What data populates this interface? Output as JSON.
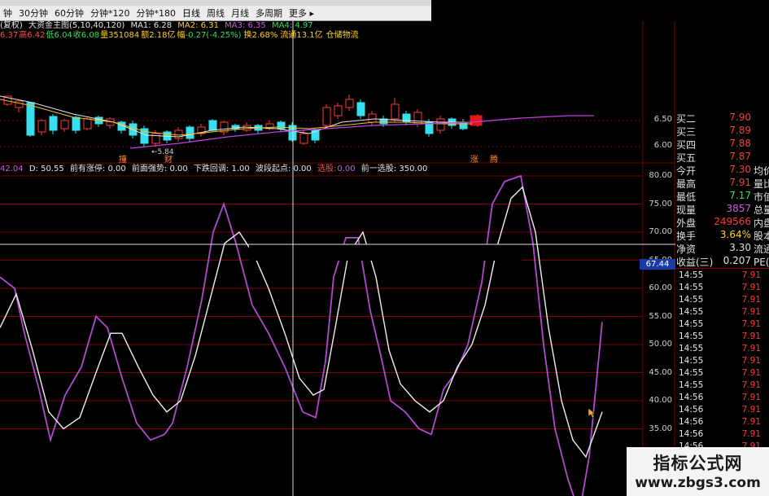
{
  "menu": {
    "periods": [
      {
        "label": "钟",
        "active": false
      },
      {
        "label": "30分钟",
        "active": false
      },
      {
        "label": "60分钟",
        "active": false
      },
      {
        "label": "分钟*120",
        "active": false
      },
      {
        "label": "分钟*180",
        "active": false
      },
      {
        "label": "日线",
        "active": true
      },
      {
        "label": "周线",
        "active": false
      },
      {
        "label": "月线",
        "active": false
      },
      {
        "label": "多周期",
        "active": false
      },
      {
        "label": "更多 ▸",
        "active": false
      }
    ]
  },
  "kline_header": {
    "name": "(复权)",
    "indicator": "大资金主图(5,10,40,120)",
    "ma1": "MA1: 6.28",
    "ma2": "MA2: 6.31",
    "ma3": "MA3: 6.35",
    "ma4": "MA4: 4.97",
    "open": "6.37",
    "high_label": "高",
    "high": "6.42",
    "low_label": "低",
    "low": "6.04",
    "close_label": "收",
    "close": "6.08",
    "vol_label": "量",
    "vol": "351084",
    "amt_label": "额",
    "amt": "2.18亿",
    "chg_label": "幅",
    "chg": "-0.27(-4.25%)",
    "turn_label": "换",
    "turn": "2.68%",
    "float_label": "流通",
    "float": "13.1亿",
    "sector": "仓储物流"
  },
  "kline": {
    "low_marker": "5.84",
    "marker_left": "撞",
    "marker_right": "财",
    "marker_sell": "涨",
    "marker_sell2": "腾",
    "axis": [
      "6.50",
      "6.00"
    ]
  },
  "osc_header": {
    "k": "42.04",
    "d": "D: 50.55",
    "items": [
      "前有涨停: 0.00",
      "前面强势: 0.00",
      "下跌回调: 1.00",
      "波段起点: 0.00"
    ],
    "pick_label": "选股:",
    "pick_value": "0.00",
    "prev": "前一选股: 350.00"
  },
  "osc_axis": [
    "80.00",
    "75.00",
    "70.00",
    "65.00",
    "60.00",
    "55.00",
    "50.00",
    "45.00",
    "40.00",
    "35.00"
  ],
  "cursor_value": "67.44",
  "order_book": [
    {
      "k": "买二",
      "v": "7.90",
      "color": "#ff3838",
      "x": ""
    },
    {
      "k": "买三",
      "v": "7.89",
      "color": "#ff3838",
      "x": ""
    },
    {
      "k": "买四",
      "v": "7.88",
      "color": "#ff3838",
      "x": ""
    },
    {
      "k": "买五",
      "v": "7.87",
      "color": "#ff3838",
      "x": ""
    },
    {
      "k": "今开",
      "v": "7.30",
      "color": "#ff3838",
      "x": "均价"
    },
    {
      "k": "最高",
      "v": "7.91",
      "color": "#ff3838",
      "x": "量比"
    },
    {
      "k": "最低",
      "v": "7.17",
      "color": "#2ee05a",
      "x": "市值"
    },
    {
      "k": "现量",
      "v": "3857",
      "color": "#d05ae0",
      "x": "总量"
    },
    {
      "k": "外盘",
      "v": "249566",
      "color": "#ff3838",
      "x": "内盘"
    },
    {
      "k": "换手",
      "v": "3.64%",
      "color": "#ffd21a",
      "x": "股本"
    },
    {
      "k": "净资",
      "v": "3.30",
      "color": "#e0e0e0",
      "x": "流通"
    },
    {
      "k": "收益(三)",
      "v": "0.207",
      "color": "#e0e0e0",
      "x": "PE(动"
    }
  ],
  "ticks": [
    {
      "t": "14:55",
      "p": "7.91"
    },
    {
      "t": "14:55",
      "p": "7.91"
    },
    {
      "t": "14:55",
      "p": "7.91"
    },
    {
      "t": "14:55",
      "p": "7.91"
    },
    {
      "t": "14:55",
      "p": "7.91"
    },
    {
      "t": "14:55",
      "p": "7.91"
    },
    {
      "t": "14:55",
      "p": "7.91"
    },
    {
      "t": "14:55",
      "p": "7.91"
    },
    {
      "t": "14:55",
      "p": "7.91"
    },
    {
      "t": "14:55",
      "p": "7.91"
    },
    {
      "t": "14:56",
      "p": "7.91"
    },
    {
      "t": "14:56",
      "p": "7.91"
    },
    {
      "t": "14:56",
      "p": "7.91"
    },
    {
      "t": "14:56",
      "p": "7.91"
    },
    {
      "t": "14:56",
      "p": "7.91"
    },
    {
      "t": "14:56",
      "p": "7.91"
    }
  ],
  "watermark": {
    "title": "指标公式网",
    "url": "www.zbgs3.com"
  },
  "colors": {
    "up": "#ff3838",
    "down": "#35e0f0",
    "k_line": "#b04ad0",
    "d_line": "#f0f0f0",
    "grid_red": "#7a0000"
  }
}
